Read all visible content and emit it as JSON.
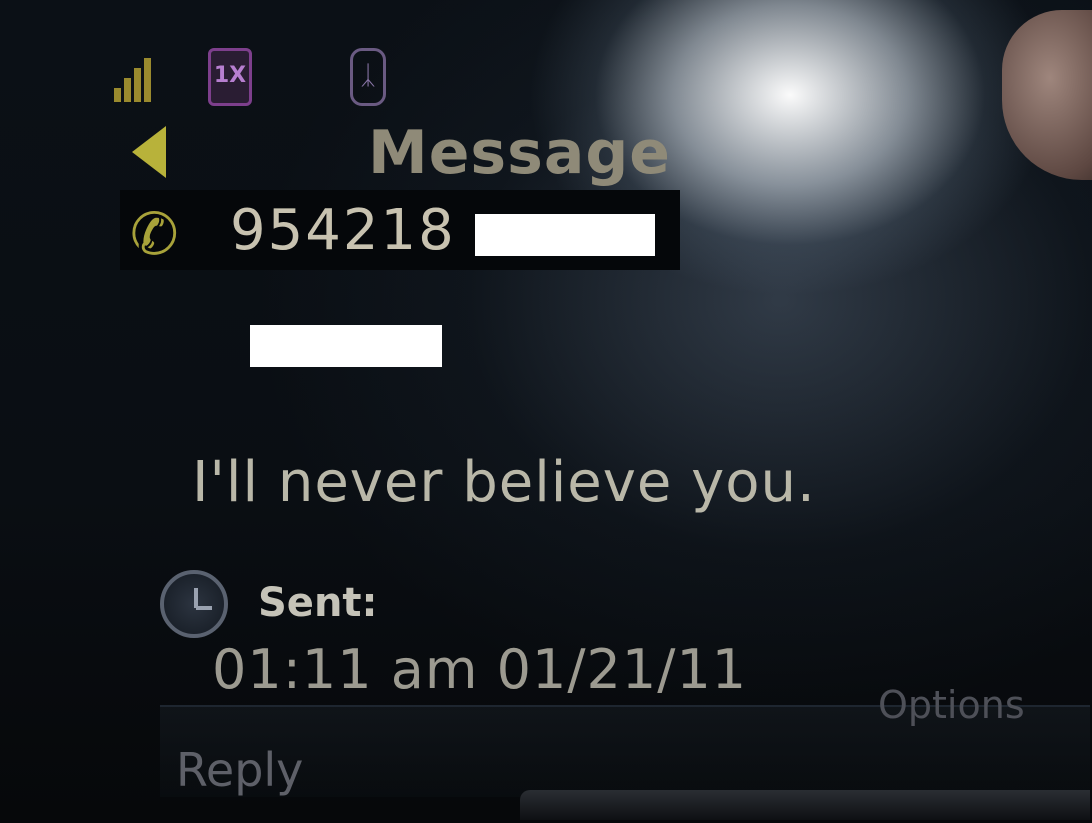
{
  "status_bar": {
    "signal_icon": "signal-strength-icon",
    "network_label": "1X",
    "bluetooth_icon": "bluetooth-icon"
  },
  "header": {
    "back_icon": "left-arrow-icon",
    "title": "Message"
  },
  "message": {
    "contact_icon": "phone-icon",
    "sender_number": "954218",
    "body": "I'll never believe you.",
    "sent_label": "Sent:",
    "sent_time": "01:11 am 01/21/11"
  },
  "softkeys": {
    "left": "Reply",
    "right": "Options"
  }
}
